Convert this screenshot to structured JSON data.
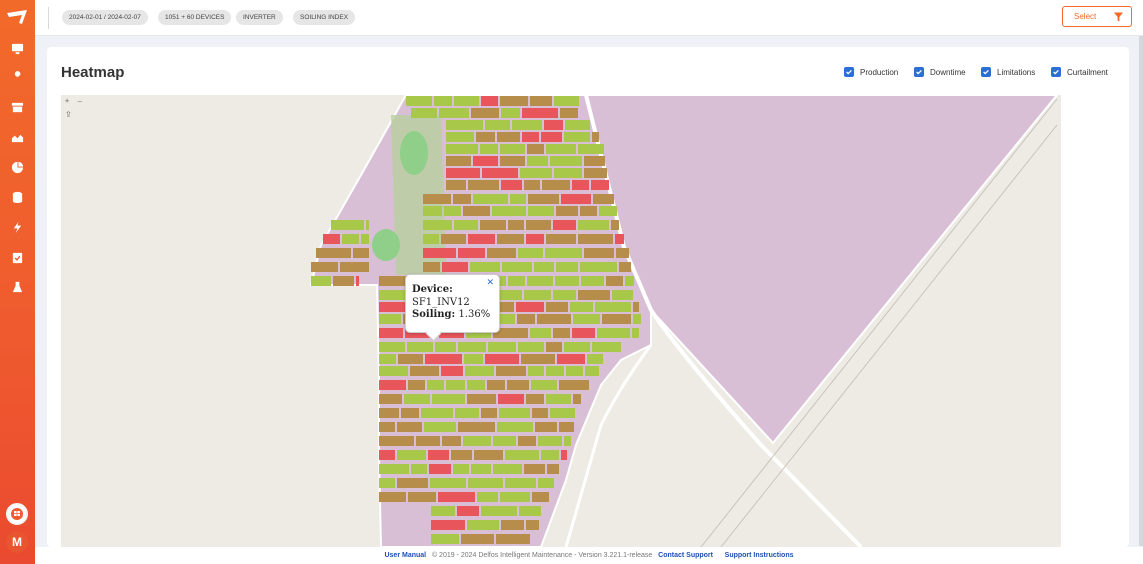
{
  "topbar": {
    "chips": [
      "2024-02-01 / 2024-02-07",
      "1051 + 60 DEVICES",
      "INVERTER",
      "SOILING INDEX"
    ],
    "select_label": "Select"
  },
  "sidebar": {
    "icons": [
      "monitor-icon",
      "wrench-icon",
      "archive-icon",
      "area-chart-icon",
      "pie-chart-icon",
      "database-icon",
      "bolt-icon",
      "clipboard-check-icon",
      "flask-icon"
    ],
    "avatar_initial": "M"
  },
  "card": {
    "title": "Heatmap",
    "filters": [
      {
        "label": "Production",
        "checked": true
      },
      {
        "label": "Downtime",
        "checked": true
      },
      {
        "label": "Limitations",
        "checked": true
      },
      {
        "label": "Curtailment",
        "checked": true
      }
    ]
  },
  "map": {
    "zoom_in": "+",
    "zoom_out": "–",
    "tooltip": {
      "device_label": "Device:",
      "device_value": "SF1_INV12",
      "soiling_label": "Soiling:",
      "soiling_value": "1.36%"
    },
    "colors": {
      "good": "#a8c84a",
      "mid": "#b68d4a",
      "bad": "#e8555a",
      "land": "#d9bfd6",
      "ground": "#eeebe5"
    }
  },
  "footer": {
    "user_manual": "User Manual",
    "copyright": "© 2019 - 2024 Delfos Intelligent Maintenance - Version 3.221.1-release",
    "contact": "Contact Support",
    "instructions": "Support Instructions"
  }
}
